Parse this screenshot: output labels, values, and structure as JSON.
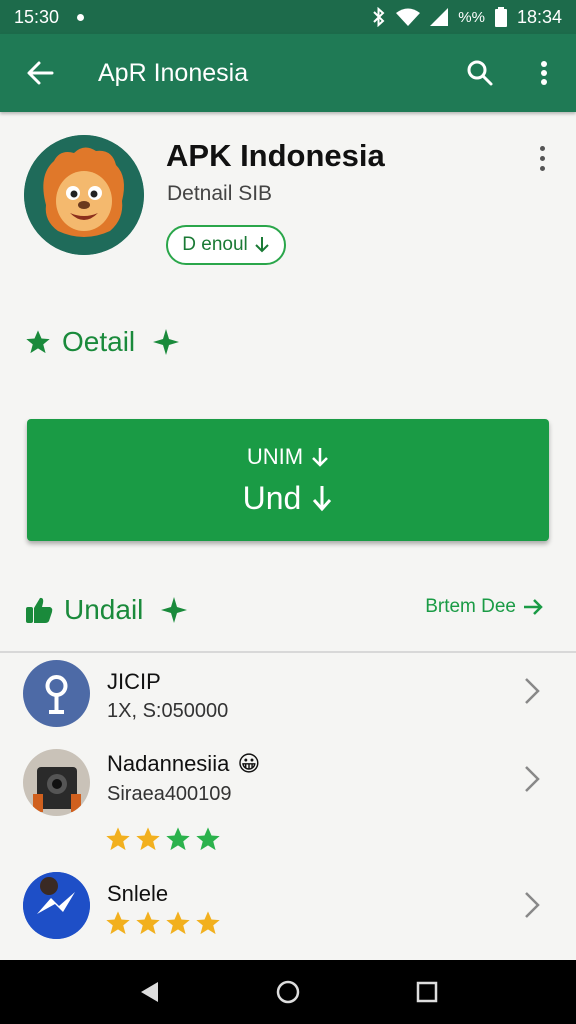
{
  "status_bar": {
    "time_left": "15:30",
    "battery_text": "%%",
    "time_right": "18:34"
  },
  "app_bar": {
    "title": "ApR Inonesia",
    "color": "#1f7a55"
  },
  "app_header": {
    "name": "APK Indonesia",
    "subtitle": "Detnail  SIB",
    "pill_label": "D enoul"
  },
  "detail_section": {
    "label": "Oetail"
  },
  "primary_button": {
    "line1": "UNIM",
    "line2": "Und"
  },
  "list_section": {
    "label": "Undail",
    "see_more": "Brtem Dee"
  },
  "list_items": [
    {
      "title": "JICIP",
      "subtitle": "1X, S:050000",
      "icon": "pin-icon"
    },
    {
      "title": "Nadannesiia",
      "subtitle": "Siraea400109",
      "emoji": "😀",
      "rating": 4,
      "icon": "camera-icon"
    },
    {
      "title": "Snlele",
      "rating": 4,
      "icon": "messenger-icon"
    }
  ],
  "colors": {
    "accent_green": "#1a9b45",
    "star_gold": "#f2b01e",
    "star_green": "#2bb24c"
  }
}
